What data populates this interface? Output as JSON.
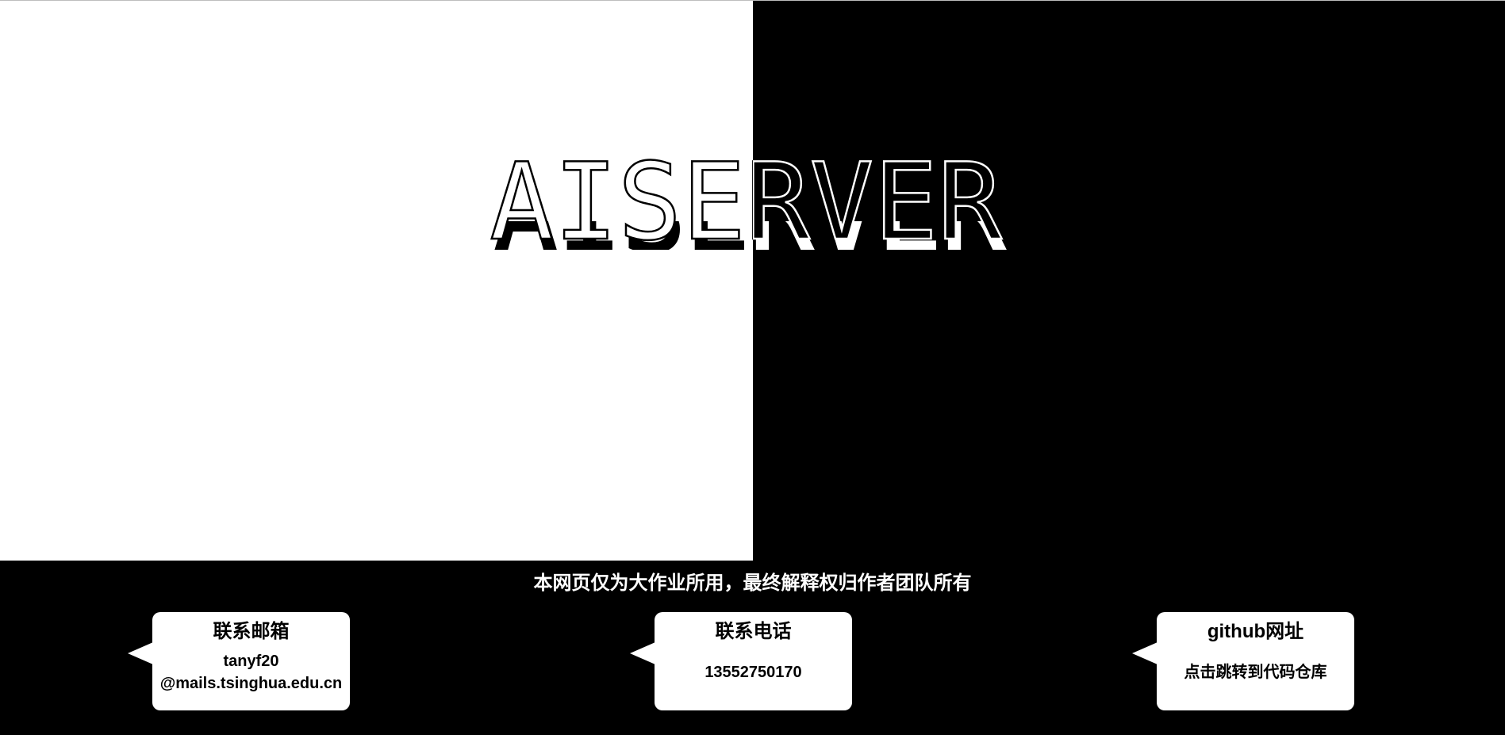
{
  "hero": {
    "title": "AISERVER",
    "colors": {
      "left": "#ffffff",
      "right": "#000000"
    }
  },
  "footer": {
    "note": "本网页仅为大作业所用，最终解释权归作者团队所有",
    "cards": [
      {
        "key": "email",
        "title": "联系邮箱",
        "value_line1": "tanyf20",
        "value_line2": "@mails.tsinghua.edu.cn"
      },
      {
        "key": "phone",
        "title": "联系电话",
        "value": "13552750170"
      },
      {
        "key": "github",
        "title": "github网址",
        "value": "点击跳转到代码仓库"
      }
    ]
  }
}
